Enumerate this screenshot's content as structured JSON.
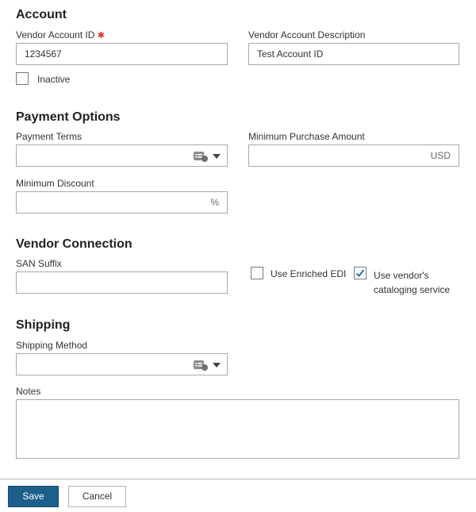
{
  "account": {
    "title": "Account",
    "vendor_account_id_label": "Vendor Account ID",
    "vendor_account_id_value": "1234567",
    "vendor_account_description_label": "Vendor Account Description",
    "vendor_account_description_value": "Test Account ID",
    "inactive_label": "Inactive",
    "inactive_checked": false
  },
  "payment_options": {
    "title": "Payment Options",
    "payment_terms_label": "Payment Terms",
    "payment_terms_value": "",
    "minimum_purchase_amount_label": "Minimum Purchase Amount",
    "minimum_purchase_amount_value": "",
    "minimum_purchase_amount_unit": "USD",
    "minimum_discount_label": "Minimum Discount",
    "minimum_discount_value": "",
    "minimum_discount_unit": "%"
  },
  "vendor_connection": {
    "title": "Vendor Connection",
    "san_suffix_label": "SAN Suffix",
    "san_suffix_value": "",
    "use_enriched_edi_label": "Use Enriched EDI",
    "use_enriched_edi_checked": false,
    "use_vendor_cataloging_label_line1": "Use vendor's",
    "use_vendor_cataloging_label_line2": "cataloging service",
    "use_vendor_cataloging_checked": true
  },
  "shipping": {
    "title": "Shipping",
    "shipping_method_label": "Shipping Method",
    "shipping_method_value": "",
    "notes_label": "Notes",
    "notes_value": ""
  },
  "footer": {
    "save_label": "Save",
    "cancel_label": "Cancel"
  },
  "icons": {
    "required": "required-asterisk-icon",
    "picker": "lookup-list-icon",
    "dropdown": "chevron-down-icon",
    "check": "checkmark-icon"
  },
  "colors": {
    "accent": "#1d5f8b",
    "required": "#e0332b",
    "check": "#2a6ea6"
  }
}
